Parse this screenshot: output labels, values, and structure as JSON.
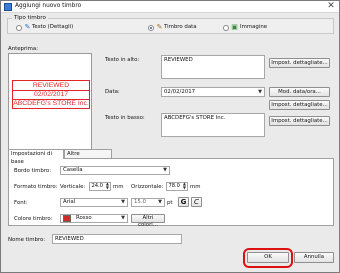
{
  "window": {
    "title": "Aggiungi nuovo timbro"
  },
  "stamp_type": {
    "group_label": "Tipo timbro",
    "options": [
      {
        "label": "Testo (Dettagli)",
        "selected": false
      },
      {
        "label": "Timbro data",
        "selected": true
      },
      {
        "label": "Immagine",
        "selected": false
      }
    ]
  },
  "preview": {
    "label": "Anteprima:",
    "top_text": "REVIEWED",
    "date_text": "02/02/2017",
    "bottom_text": "ABCDEFG's STORE Inc.",
    "stamp_color": "#e0282a"
  },
  "fields": {
    "top_label": "Testo in alto:",
    "top_value": "REVIEWED",
    "top_button": "Impost. dettagliate...",
    "date_label": "Data:",
    "date_value": "02/02/2017",
    "date_button": "Mod. data/ora...",
    "date_detail_button": "Impost. dettagliate...",
    "bottom_label": "Testo in basso:",
    "bottom_value": "ABCDEFG's STORE Inc.",
    "bottom_button": "Impost. dettagliate..."
  },
  "tabs": [
    {
      "label": "Impostazioni di base",
      "active": true
    },
    {
      "label": "Altre impostazioni",
      "active": false
    }
  ],
  "basic": {
    "border_label": "Bordo timbro:",
    "border_value": "Casella",
    "format_label": "Formato timbro:",
    "vertical_label": "Verticale:",
    "vertical_value": "24.0",
    "vertical_unit": "mm",
    "horizontal_label": "Orizzontale:",
    "horizontal_value": "78.0",
    "horizontal_unit": "mm",
    "font_label": "Font:",
    "font_value": "Arial",
    "font_size_value": "15.0",
    "font_size_unit": "pt",
    "bold_label": "G",
    "italic_label": "C",
    "color_label": "Colore timbro:",
    "color_value": "Rosso",
    "color_hex": "#d62828",
    "more_colors_button": "Altri colori..."
  },
  "name": {
    "label": "Nome timbro:",
    "value": "REVIEWED"
  },
  "actions": {
    "ok_label": "OK",
    "cancel_label": "Annulla",
    "highlight_color": "#dd1111"
  }
}
